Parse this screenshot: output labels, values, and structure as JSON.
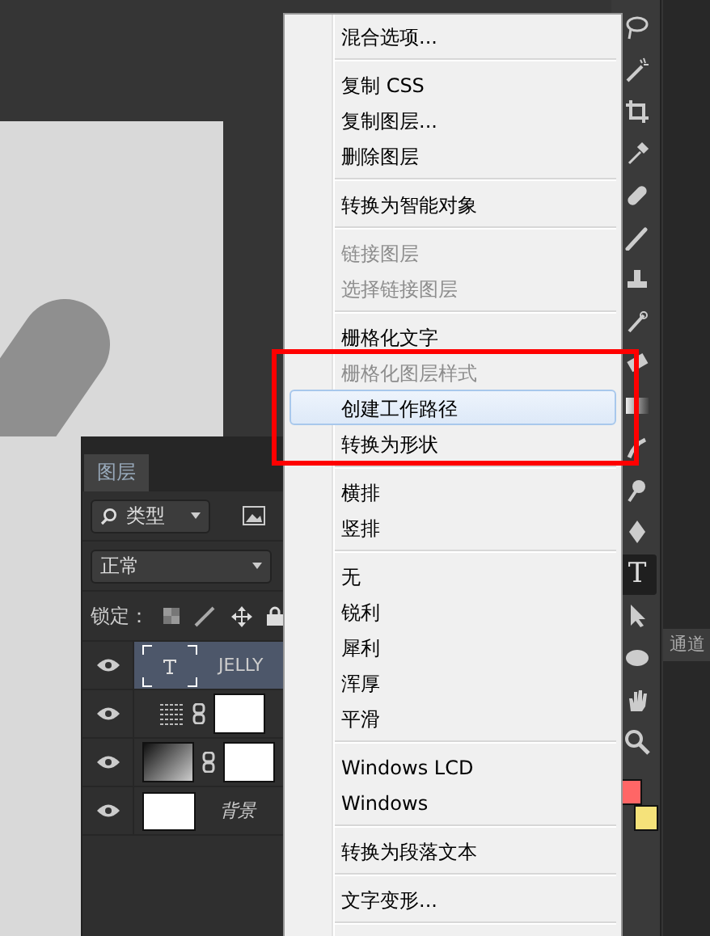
{
  "layers_panel": {
    "tab": "图层",
    "filter": {
      "value": "类型"
    },
    "blend_mode": {
      "value": "正常"
    },
    "lock_label": "锁定：",
    "layers": [
      {
        "kind": "text",
        "name": "JELLY",
        "selected": true
      },
      {
        "kind": "pattern",
        "selected": false
      },
      {
        "kind": "gradient",
        "selected": false
      },
      {
        "kind": "plain",
        "name": "背景",
        "selected": false
      }
    ]
  },
  "context_menu": {
    "groups": [
      [
        {
          "label": "混合选项...",
          "disabled": false,
          "selected": false
        }
      ],
      [
        {
          "label": "复制 CSS",
          "disabled": false,
          "selected": false
        },
        {
          "label": "复制图层...",
          "disabled": false,
          "selected": false
        },
        {
          "label": "删除图层",
          "disabled": false,
          "selected": false
        }
      ],
      [
        {
          "label": "转换为智能对象",
          "disabled": false,
          "selected": false
        }
      ],
      [
        {
          "label": "链接图层",
          "disabled": true,
          "selected": false
        },
        {
          "label": "选择链接图层",
          "disabled": true,
          "selected": false
        }
      ],
      [
        {
          "label": "栅格化文字",
          "disabled": false,
          "selected": false
        },
        {
          "label": "栅格化图层样式",
          "disabled": true,
          "selected": false,
          "framed": true
        },
        {
          "label": "创建工作路径",
          "disabled": false,
          "selected": true,
          "framed": true
        },
        {
          "label": "转换为形状",
          "disabled": false,
          "selected": false,
          "framed": true
        }
      ],
      [
        {
          "label": "横排",
          "disabled": false,
          "selected": false
        },
        {
          "label": "竖排",
          "disabled": false,
          "selected": false
        }
      ],
      [
        {
          "label": "无",
          "disabled": false,
          "selected": false
        },
        {
          "label": "锐利",
          "disabled": false,
          "selected": false
        },
        {
          "label": "犀利",
          "disabled": false,
          "selected": false
        },
        {
          "label": "浑厚",
          "disabled": false,
          "selected": false
        },
        {
          "label": "平滑",
          "disabled": false,
          "selected": false
        }
      ],
      [
        {
          "label": "Windows LCD",
          "disabled": false,
          "selected": false
        },
        {
          "label": "Windows",
          "disabled": false,
          "selected": false
        }
      ],
      [
        {
          "label": "转换为段落文本",
          "disabled": false,
          "selected": false
        }
      ],
      [
        {
          "label": "文字变形...",
          "disabled": false,
          "selected": false
        }
      ]
    ]
  },
  "toolbar": {
    "tools": [
      {
        "kind": "lasso",
        "selected": false
      },
      {
        "kind": "wand",
        "selected": false
      },
      {
        "kind": "crop",
        "selected": false
      },
      {
        "kind": "eyedropper",
        "selected": false
      },
      {
        "kind": "bandage",
        "selected": false
      },
      {
        "kind": "brush",
        "selected": false
      },
      {
        "kind": "stamp",
        "selected": false
      },
      {
        "kind": "history",
        "selected": false
      },
      {
        "kind": "eraser",
        "selected": false
      },
      {
        "kind": "gradient",
        "selected": false
      },
      {
        "kind": "smudge",
        "selected": false
      },
      {
        "kind": "dodge",
        "selected": false
      },
      {
        "kind": "pen",
        "selected": false
      },
      {
        "kind": "type",
        "label": "T",
        "selected": true
      },
      {
        "kind": "arrow",
        "selected": false
      },
      {
        "kind": "ellipse",
        "selected": false
      },
      {
        "kind": "hand",
        "selected": false
      },
      {
        "kind": "zoom",
        "selected": false
      }
    ],
    "foreground": {
      "color": "#ff6666"
    },
    "background": {
      "color": "#f5e27a"
    }
  },
  "side_panel": {
    "tab": "通道"
  }
}
